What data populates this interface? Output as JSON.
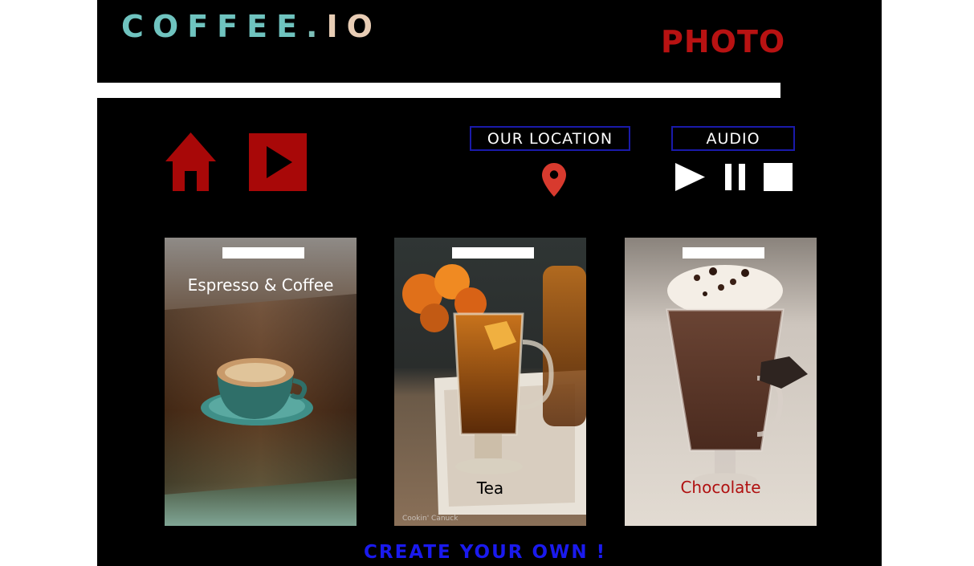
{
  "header": {
    "logo_part1": "COFFEE",
    "logo_part2": ".",
    "logo_part3": "IO",
    "title": "PHOTO"
  },
  "nav": {
    "home_icon": "home-icon",
    "video_icon": "play-video-icon"
  },
  "location": {
    "label": "OUR LOCATION",
    "icon": "map-pin-icon"
  },
  "audio": {
    "label": "AUDIO",
    "controls": [
      "play-icon",
      "pause-icon",
      "stop-icon"
    ]
  },
  "cards": [
    {
      "caption": "Espresso & Coffee",
      "caption_color": "#ffffff"
    },
    {
      "caption": "Tea",
      "caption_color": "#000000"
    },
    {
      "caption": "Chocolate",
      "caption_color": "#b01010"
    }
  ],
  "photo_credit": "Cookin' Canuck",
  "cta": {
    "label": "CREATE YOUR OWN !"
  },
  "colors": {
    "accent_red": "#a80808",
    "title_red": "#b81212",
    "cta_blue": "#1a1aee",
    "box_border": "#1a1aaa",
    "logo_teal": "#6fc3bf",
    "logo_sand": "#e8cdb5"
  }
}
